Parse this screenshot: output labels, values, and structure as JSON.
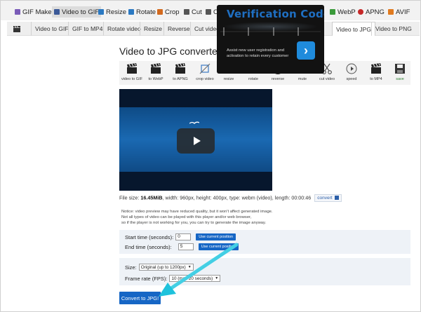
{
  "topnav": {
    "items": [
      {
        "label": "GIF Maker",
        "color": "#7a5cb8"
      },
      {
        "label": "Video to GIF",
        "color": "#3b5998",
        "active": true
      },
      {
        "label": "Resize",
        "color": "#2b79c2"
      },
      {
        "label": "Rotate",
        "color": "#2b79c2"
      },
      {
        "label": "Crop",
        "color": "#d2691e"
      },
      {
        "label": "Cut",
        "color": "#555555"
      },
      {
        "label": "Optim",
        "color": "#555555"
      },
      {
        "label": "WebP",
        "color": "#3a9a3a"
      },
      {
        "label": "APNG",
        "color": "#c62828"
      },
      {
        "label": "AVIF",
        "color": "#e07a1f"
      }
    ]
  },
  "subnav": {
    "tabs": [
      {
        "label": "Video to GIF"
      },
      {
        "label": "GIF to MP4"
      },
      {
        "label": "Rotate video"
      },
      {
        "label": "Resize"
      },
      {
        "label": "Reverse"
      },
      {
        "label": "Cut video"
      },
      {
        "label": "Video to JPG",
        "active": true
      },
      {
        "label": "Video to PNG"
      }
    ]
  },
  "page": {
    "title": "Video to JPG converter"
  },
  "tools": [
    {
      "label": "video to GIF",
      "icon": "clapperboard-icon"
    },
    {
      "label": "to WebP",
      "icon": "clapperboard-icon"
    },
    {
      "label": "to APNG",
      "icon": "clapperboard-icon"
    },
    {
      "label": "crop video",
      "icon": "crop-icon"
    },
    {
      "label": "resize",
      "icon": "resize-icon"
    },
    {
      "label": "rotate",
      "icon": "rotate-icon"
    },
    {
      "label": "reverse",
      "icon": "rewind-icon"
    },
    {
      "label": "mute",
      "icon": "mute-icon"
    },
    {
      "label": "cut video",
      "icon": "scissors-icon"
    },
    {
      "label": "speed",
      "icon": "speed-icon"
    },
    {
      "label": "to MP4",
      "icon": "clapperboard-icon"
    },
    {
      "label": "save",
      "icon": "save-icon"
    }
  ],
  "fileinfo": {
    "prefix": "File size:",
    "size": "16.45MiB",
    "details": ", width: 960px, height: 400px, type: webm (video), length: 00:00:46",
    "convert_label": "convert"
  },
  "notice": {
    "line1": "Notice: video preview may have reduced quality, but it won't affect generated image.",
    "line2": "Not all types of video can be played with this player and/or web browser,",
    "line3": "so if the player is not working for you, you can try to generate the image anyway."
  },
  "form": {
    "start_label": "Start time (seconds):",
    "start_value": "0",
    "end_label": "End time (seconds):",
    "end_value": "5",
    "use_current_label": "Use current position",
    "size_label": "Size:",
    "size_value": "Original (up to 1200px)",
    "fps_label": "Frame rate (FPS):",
    "fps_value": "10 (max 20 seconds)",
    "submit_label": "Convert to JPG!"
  },
  "popup": {
    "title": "Verification Code",
    "text": "Assist new user registration and activation to retain every customer",
    "arrow": "›"
  }
}
